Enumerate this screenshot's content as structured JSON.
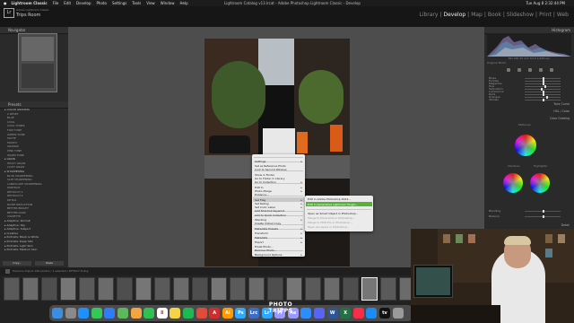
{
  "menubar": {
    "apple": "",
    "items": [
      "Lightroom Classic",
      "File",
      "Edit",
      "Develop",
      "Photo",
      "Settings",
      "Tools",
      "View",
      "Window",
      "Help"
    ],
    "title": "Lightroom Catalog v13.lrcat - Adobe Photoshop Lightroom Classic - Develop",
    "clock": "Tue Aug 8  2:32:44 PM"
  },
  "identity": {
    "logo": "Lr",
    "brand": "Adobe Lightroom Classic",
    "user": "Trips Room"
  },
  "modules": {
    "items": [
      "Library",
      "Develop",
      "Map",
      "Book",
      "Slideshow",
      "Print",
      "Web"
    ],
    "active": "Develop"
  },
  "left_panel": {
    "navigator": "Navigator",
    "presets": "Presets",
    "preset_items": [
      {
        "label": "COLOR GRADING",
        "group": true
      },
      {
        "label": "A RESET",
        "group": false
      },
      {
        "label": "BLUE",
        "group": false
      },
      {
        "label": "COOL",
        "group": false
      },
      {
        "label": "COOL TONES",
        "group": false
      },
      {
        "label": "FILM TONE",
        "group": false
      },
      {
        "label": "GREEN TONE",
        "group": false
      },
      {
        "label": "MATTE",
        "group": false
      },
      {
        "label": "MOODY",
        "group": false
      },
      {
        "label": "ORANGE",
        "group": false
      },
      {
        "label": "PINK TONE",
        "group": false
      },
      {
        "label": "WARM TONE",
        "group": false
      },
      {
        "label": "GRAIN",
        "group": true
      },
      {
        "label": "HEAVY GRAIN",
        "group": false
      },
      {
        "label": "LIGHT GRAIN",
        "group": false
      },
      {
        "label": "SHARPENING",
        "group": true
      },
      {
        "label": "BLUR SHARPENING",
        "group": false
      },
      {
        "label": "SLIM SHARPENING",
        "group": false
      },
      {
        "label": "LANDSCAPE SHARPENING",
        "group": false
      },
      {
        "label": "PORTRAIT",
        "group": false
      },
      {
        "label": "RETOUCH 1",
        "group": false
      },
      {
        "label": "RETOUCH 2",
        "group": false
      },
      {
        "label": "DETAIL",
        "group": false
      },
      {
        "label": "NOISE REDUCTION",
        "group": false
      },
      {
        "label": "BETTER BRIGHT",
        "group": false
      },
      {
        "label": "BETTER DARK",
        "group": false
      },
      {
        "label": "VIGNETTE",
        "group": false
      },
      {
        "label": "Adaptive: Portrait",
        "group": true
      },
      {
        "label": "Adaptive: Sky",
        "group": true
      },
      {
        "label": "Adaptive: Subject",
        "group": true
      },
      {
        "label": "Creative",
        "group": true
      },
      {
        "label": "Portraits: Black & White",
        "group": true
      },
      {
        "label": "Portraits: Deep Skin",
        "group": true
      },
      {
        "label": "Portraits: Light Skin",
        "group": true
      },
      {
        "label": "Portraits: Medium Skin",
        "group": true
      }
    ],
    "copy_btn": "Copy...",
    "paste_btn": "Paste"
  },
  "context_menu": {
    "items": [
      {
        "label": "Settings",
        "arrow": true
      },
      {
        "label": "Set as Reference Photo",
        "arrow": false
      },
      {
        "label": "Lock to Second Window",
        "arrow": false
      },
      {
        "label": "Show in Finder",
        "arrow": false
      },
      {
        "label": "Go to Folder in Library",
        "arrow": false
      },
      {
        "label": "Go to Collection",
        "arrow": true
      },
      {
        "label": "Edit In",
        "arrow": true
      },
      {
        "label": "Photo Merge",
        "arrow": true
      },
      {
        "label": "Enhance...",
        "arrow": false
      },
      {
        "label": "Set Flag",
        "arrow": true
      },
      {
        "label": "Set Rating",
        "arrow": true
      },
      {
        "label": "Set Color Label",
        "arrow": true
      },
      {
        "label": "Add Shortcut Keyword",
        "arrow": false
      },
      {
        "label": "Add to Quick Collection",
        "arrow": false
      },
      {
        "label": "Stacking",
        "arrow": true
      },
      {
        "label": "Create Virtual Copy",
        "arrow": false
      },
      {
        "label": "Metadata Presets",
        "arrow": true
      },
      {
        "label": "Transform",
        "arrow": true
      },
      {
        "label": "Metadata",
        "arrow": true
      },
      {
        "label": "Export",
        "arrow": true
      },
      {
        "label": "Email Photo...",
        "arrow": false
      },
      {
        "label": "Remove Photo...",
        "arrow": false
      },
      {
        "label": "Background Options",
        "arrow": true
      }
    ]
  },
  "submenu": {
    "items": [
      {
        "label": "Edit in Adobe Photoshop 2024...",
        "state": "normal"
      },
      {
        "label": "Edit in Generative Lightroom Plugin...",
        "state": "selected"
      },
      {
        "label": "Open as Smart Object in Photoshop...",
        "state": "normal"
      },
      {
        "label": "Merge to Panorama in Photoshop...",
        "state": "disabled"
      },
      {
        "label": "Merge to HDR Pro in Photoshop...",
        "state": "disabled"
      },
      {
        "label": "Open as Layers in Photoshop...",
        "state": "disabled"
      }
    ]
  },
  "right_panel": {
    "histogram": "Histogram",
    "histinfo": "ISO 200    30 mm    f/4.0    1/250 sec",
    "original_photo": "Original Photo",
    "sliders": [
      {
        "label": "Blues",
        "value": 0.5
      },
      {
        "label": "Purples",
        "value": 0.5
      },
      {
        "label": "Magentas",
        "value": 0.5
      },
      {
        "label": "Hue",
        "value": 0.55
      },
      {
        "label": "Saturation",
        "value": 0.45
      },
      {
        "label": "Luminance",
        "value": 0.5
      },
      {
        "label": "Reds",
        "value": 0.5
      },
      {
        "label": "Oranges",
        "value": 0.6
      },
      {
        "label": "Yellows",
        "value": 0.5
      }
    ],
    "tone_curve": "Tone Curve",
    "hsl": "HSL / Color",
    "color_grading": "Color Grading",
    "midtones": "Midtones",
    "shadows": "Shadows",
    "highlights": "Highlights",
    "blending": "Blending",
    "balance": "Balance",
    "detail": "Detail",
    "previous_btn": "Previous",
    "reset_btn": "Reset"
  },
  "toolbar": {
    "filmbar": "Previous Import    196 photos / 1 selected / DF5D17 8.dng"
  },
  "dock": {
    "apps": [
      {
        "name": "finder-icon",
        "color": "#3b8ee0",
        "glyph": ""
      },
      {
        "name": "launchpad-icon",
        "color": "#8a8a8a",
        "glyph": ""
      },
      {
        "name": "safari-icon",
        "color": "#1e90ff",
        "glyph": ""
      },
      {
        "name": "messages-icon",
        "color": "#34c759",
        "glyph": ""
      },
      {
        "name": "mail-icon",
        "color": "#2f7cf6",
        "glyph": ""
      },
      {
        "name": "maps-icon",
        "color": "#5bb85b",
        "glyph": ""
      },
      {
        "name": "photos-icon",
        "color": "#f2a541",
        "glyph": ""
      },
      {
        "name": "facetime-icon",
        "color": "#2fbf52",
        "glyph": ""
      },
      {
        "name": "calendar-icon",
        "color": "#ffffff",
        "glyph": "8"
      },
      {
        "name": "notes-icon",
        "color": "#f5d547",
        "glyph": ""
      },
      {
        "name": "spotify-icon",
        "color": "#1db954",
        "glyph": ""
      },
      {
        "name": "chrome-icon",
        "color": "#e04b3a",
        "glyph": ""
      },
      {
        "name": "acrobat-icon",
        "color": "#d42b2b",
        "glyph": "A"
      },
      {
        "name": "illustrator-icon",
        "color": "#ff9a00",
        "glyph": "Ai"
      },
      {
        "name": "photoshop-icon",
        "color": "#31a8ff",
        "glyph": "Ps"
      },
      {
        "name": "lightroom-classic-icon",
        "color": "#3d6cc4",
        "glyph": "Lrc"
      },
      {
        "name": "lightroom-icon",
        "color": "#31a8ff",
        "glyph": "Lr"
      },
      {
        "name": "premiere-icon",
        "color": "#9999ff",
        "glyph": "Pr"
      },
      {
        "name": "after-effects-icon",
        "color": "#9999ff",
        "glyph": "Ae"
      },
      {
        "name": "zoom-icon",
        "color": "#2d8cff",
        "glyph": ""
      },
      {
        "name": "discord-icon",
        "color": "#5865f2",
        "glyph": ""
      },
      {
        "name": "word-icon",
        "color": "#2b579a",
        "glyph": "W"
      },
      {
        "name": "excel-icon",
        "color": "#217346",
        "glyph": "X"
      },
      {
        "name": "music-icon",
        "color": "#fa2d48",
        "glyph": ""
      },
      {
        "name": "appstore-icon",
        "color": "#1c8cf2",
        "glyph": ""
      },
      {
        "name": "appletv-icon",
        "color": "#111111",
        "glyph": "tv"
      },
      {
        "name": "trash-icon",
        "color": "#9a9a9a",
        "glyph": ""
      }
    ]
  },
  "watermark": "PHOTO TRIPPS"
}
